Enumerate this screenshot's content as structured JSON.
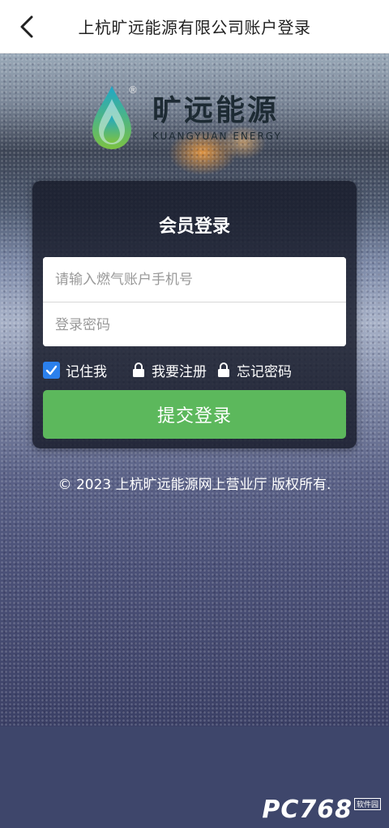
{
  "header": {
    "title": "上杭旷远能源有限公司账户登录"
  },
  "logo": {
    "name_cn": "旷远能源",
    "name_en": "KUANGYUAN ENERGY",
    "registered_mark": "®"
  },
  "login_card": {
    "title": "会员登录",
    "account_placeholder": "请输入燃气账户手机号",
    "password_placeholder": "登录密码",
    "remember_label": "记住我",
    "remember_checked": true,
    "register_label": "我要注册",
    "forgot_label": "忘记密码",
    "submit_label": "提交登录"
  },
  "footer": {
    "copyright": "© 2023 上杭旷远能源网上营业厅 版权所有."
  },
  "watermark": {
    "text": "PC768",
    "tag": "软件园"
  },
  "colors": {
    "accent_green": "#5cb85c",
    "checkbox_blue": "#2b80ec",
    "page_bg": "#3e466b"
  }
}
